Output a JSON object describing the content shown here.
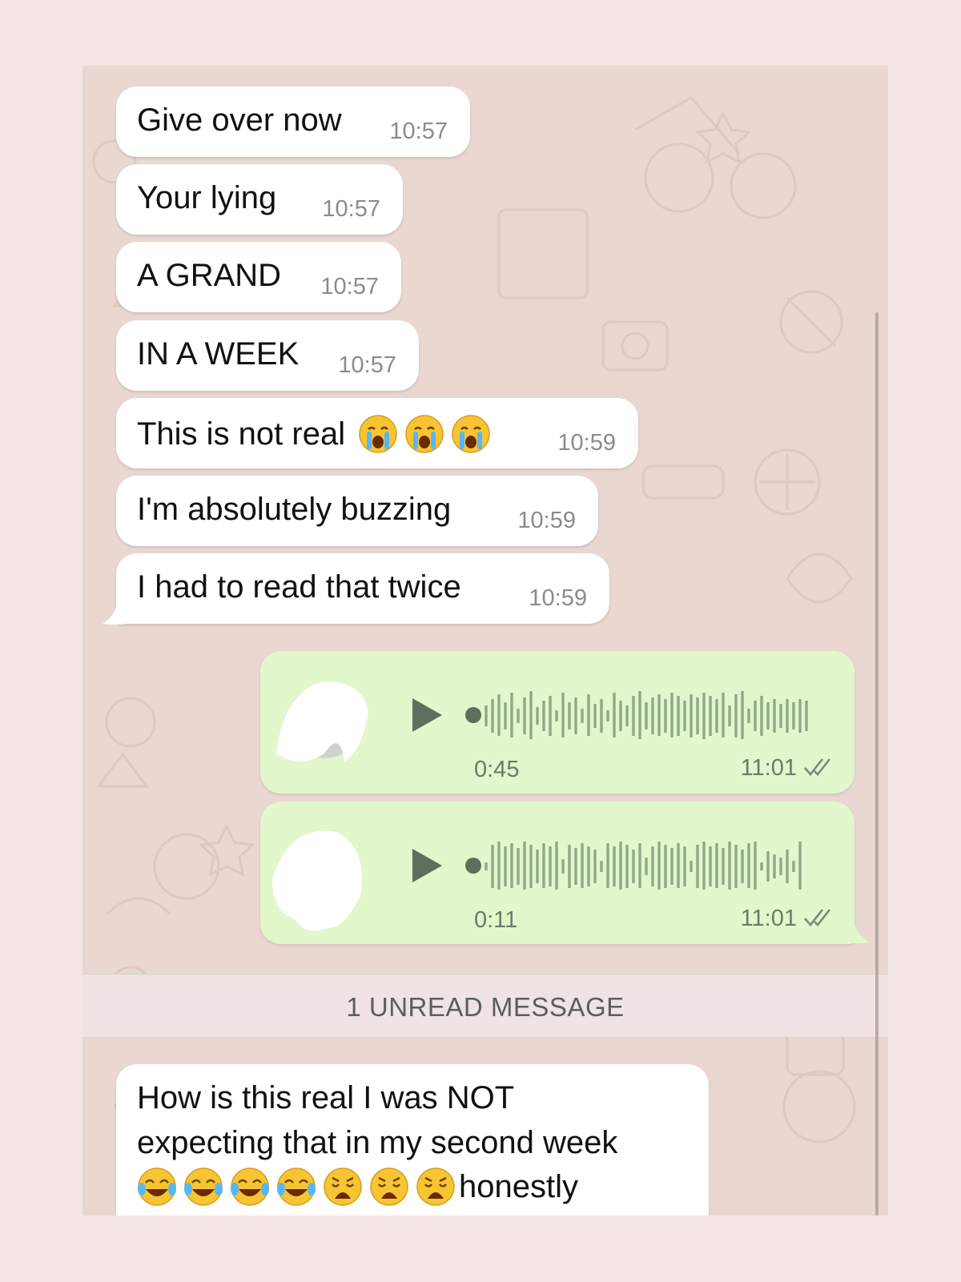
{
  "incoming_messages": [
    {
      "text": "Give over now",
      "time": "10:57"
    },
    {
      "text": "Your lying",
      "time": "10:57"
    },
    {
      "text": "A GRAND",
      "time": "10:57"
    },
    {
      "text": "IN A WEEK",
      "time": "10:57"
    },
    {
      "text": "This is not real",
      "emoji": [
        "crying-face",
        "crying-face",
        "crying-face"
      ],
      "time": "10:59"
    },
    {
      "text": "I'm absolutely buzzing",
      "time": "10:59"
    },
    {
      "text": "I had to read that twice",
      "time": "10:59"
    }
  ],
  "voice_notes": [
    {
      "duration": "0:45",
      "time": "11:01",
      "status": "read"
    },
    {
      "duration": "0:11",
      "time": "11:01",
      "status": "read"
    }
  ],
  "unread_banner": "1 UNREAD MESSAGE",
  "last_message": {
    "line1": "How is this real I was NOT",
    "line2": "expecting that in my second week",
    "emoji": [
      "joy-face",
      "joy-face",
      "joy-face",
      "joy-face",
      "weary-face",
      "weary-face",
      "weary-face"
    ],
    "line3_text": "honestly"
  },
  "colors": {
    "page_bg": "#f3e6e5",
    "chat_bg": "#ead7d1",
    "incoming_bubble": "#ffffff",
    "outgoing_bubble": "#e2f7cb",
    "meta_text": "#8b8b8b"
  }
}
